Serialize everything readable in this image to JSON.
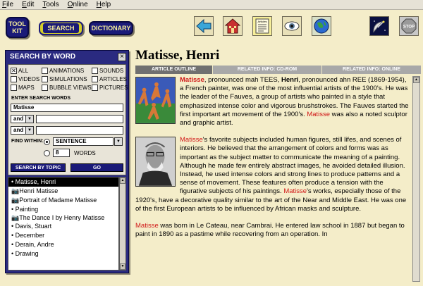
{
  "menu": [
    {
      "first": "F",
      "rest": "ile"
    },
    {
      "first": "E",
      "rest": "dit"
    },
    {
      "first": "T",
      "rest": "ools"
    },
    {
      "first": "O",
      "rest": "nline"
    },
    {
      "first": "H",
      "rest": "elp"
    }
  ],
  "toolbar": {
    "toolkit_line1": "TOOL",
    "toolkit_line2": "KIT",
    "search_label": "SEARCH",
    "dictionary_label": "DICTIONARY",
    "articles_icon_text": "Articles",
    "icons": [
      "back-arrow-icon",
      "home-icon",
      "articles-icon",
      "eye-icon",
      "globe-icon",
      "satellite-dish-icon",
      "stop-icon"
    ],
    "stop_label": "STOP"
  },
  "search_panel": {
    "title": "SEARCH BY WORD",
    "close_label": "×",
    "filters": [
      {
        "label": "ALL",
        "checked": true
      },
      {
        "label": "ANIMATIONS",
        "checked": false
      },
      {
        "label": "SOUNDS",
        "checked": false
      },
      {
        "label": "VIDEOS",
        "checked": false
      },
      {
        "label": "SIMULATIONS",
        "checked": false
      },
      {
        "label": "ARTICLES",
        "checked": false
      },
      {
        "label": "MAPS",
        "checked": false
      },
      {
        "label": "BUBBLE VIEWS",
        "checked": false
      },
      {
        "label": "PICTURES",
        "checked": false
      }
    ],
    "enter_words_label": "ENTER SEARCH WORDS",
    "word1": "Matisse",
    "op1": "and",
    "op2": "and",
    "word2": "",
    "word3": "",
    "find_within_label": "FIND WITHIN:",
    "within_option": "SENTENCE",
    "words_count": "8",
    "words_label": "WORDS",
    "search_topic_label": "SEARCH BY TOPIC",
    "go_label": "GO",
    "results": [
      {
        "text": "Matisse, Henri",
        "selected": true,
        "icon": "bullet"
      },
      {
        "text": "Henri Matisse",
        "selected": false,
        "icon": "camera-icon"
      },
      {
        "text": "Portrait of Madame Matisse",
        "selected": false,
        "icon": "camera-icon"
      },
      {
        "text": "Painting",
        "selected": false,
        "icon": "bullet"
      },
      {
        "text": "The Dance I by Henry Matisse",
        "selected": false,
        "icon": "camera-icon"
      },
      {
        "text": "Davis, Stuart",
        "selected": false,
        "icon": "bullet"
      },
      {
        "text": "December",
        "selected": false,
        "icon": "bullet"
      },
      {
        "text": "Derain, Andre",
        "selected": false,
        "icon": "bullet"
      },
      {
        "text": "Drawing",
        "selected": false,
        "icon": "bullet"
      }
    ]
  },
  "article": {
    "title": "Matisse, Henri",
    "tabs": [
      "ARTICLE OUTLINE",
      "RELATED INFO: CD-ROM",
      "RELATED INFO: ONLINE"
    ],
    "p1": {
      "t1": "Matisse",
      "t2": ", pronounced mah TEES, ",
      "t3": "Henri",
      "t4": ", pronounced ahn REE (1869-1954), a French painter, was one of the most influential artists of the 1900's.  He was the leader of the Fauves, a group of artists who painted in a style that emphasized intense color and vigorous brushstrokes.  The Fauves started the first important art movement of the 1900's.  ",
      "t5": "Matisse",
      "t6": " was also a noted sculptor and graphic artist."
    },
    "p2": {
      "t1": "Matisse",
      "t2": "'s favorite subjects included human figures, still lifes, and scenes of interiors.  He believed that the arrangement of colors and forms was as important as the subject matter to communicate the meaning of a painting.  Although he made few entirely abstract images, he avoided detailed illusion.  Instead, he used intense colors and strong lines to produce patterns and a sense of movement.  These features often produce a tension with the figurative subjects of his paintings.  ",
      "t3": "Matisse",
      "t4": "'s works, especially those of the 1920's, have a decorative quality similar to the art of the Near and Middle East.  He was one of the first European artists to be influenced by African masks and sculpture."
    },
    "p3": {
      "t1": "Matisse",
      "t2": " was born in Le Cateau, near Cambrai.  He entered law school in 1887 but began to paint in 1890 as a pastime while recovering from an operation.  In"
    }
  }
}
